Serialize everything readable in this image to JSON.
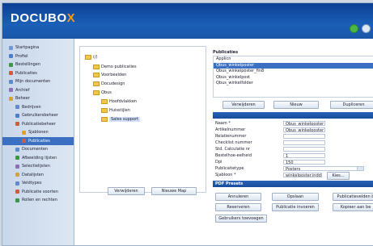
{
  "app": {
    "logo_main": "DOCUBO",
    "logo_accent": "X"
  },
  "colors": {
    "header": "#1b5fb8",
    "accent": "#f59a1b",
    "selection": "#3b6fc2"
  },
  "sidebar": {
    "items": [
      {
        "label": "Startpagina",
        "icon": "home-icon",
        "color": "#6a9ad6"
      },
      {
        "label": "Profiel",
        "icon": "user-icon",
        "color": "#4a7fcf"
      },
      {
        "label": "Bestellingen",
        "icon": "cart-icon",
        "color": "#3a9a44"
      },
      {
        "label": "Publicaties",
        "icon": "book-icon",
        "color": "#d25b3a"
      },
      {
        "label": "Mijn documenten",
        "icon": "document-icon",
        "color": "#5b8bd0"
      },
      {
        "label": "Archief",
        "icon": "archive-icon",
        "color": "#8c6fb8"
      },
      {
        "label": "Beheer",
        "icon": "admin-icon",
        "color": "#d4a33a"
      },
      {
        "label": "Bedrijven",
        "icon": "company-icon",
        "color": "#5b8bd0"
      },
      {
        "label": "Gebruikersbeheer",
        "icon": "users-icon",
        "color": "#4a7fcf"
      },
      {
        "label": "Publicatiebeheer",
        "icon": "publication-icon",
        "color": "#d25b3a"
      },
      {
        "label": "Sjablonen",
        "icon": "template-icon",
        "color": "#e0a21a"
      },
      {
        "label": "Publicaties",
        "icon": "book-icon",
        "color": "#d25b3a",
        "selected": true
      },
      {
        "label": "Documenten",
        "icon": "document-icon",
        "color": "#5b8bd0"
      },
      {
        "label": "Afbeelding lijsten",
        "icon": "image-icon",
        "color": "#3a9a44"
      },
      {
        "label": "Selectielijsten",
        "icon": "list-icon",
        "color": "#8c6fb8"
      },
      {
        "label": "Datalijsten",
        "icon": "data-icon",
        "color": "#d4a33a"
      },
      {
        "label": "Veldtypes",
        "icon": "field-icon",
        "color": "#5b8bd0"
      },
      {
        "label": "Publicatie soorten",
        "icon": "category-icon",
        "color": "#d25b3a"
      },
      {
        "label": "Rollen en rechten",
        "icon": "key-icon",
        "color": "#3a9a44"
      }
    ]
  },
  "tree": {
    "root": "(/)",
    "items": [
      {
        "label": "Demo publicaties",
        "depth": 1
      },
      {
        "label": "Voorbeelden",
        "depth": 1
      },
      {
        "label": "Docudesign",
        "depth": 1
      },
      {
        "label": "Qbus",
        "depth": 1
      },
      {
        "label": "Hoofdvlakken",
        "depth": 2
      },
      {
        "label": "Huisstijlen",
        "depth": 2
      },
      {
        "label": "Sales support",
        "depth": 2,
        "selected": true
      }
    ],
    "buttons": {
      "remove": "Verwijderen",
      "new_folder": "Nieuwe Map"
    }
  },
  "publications": {
    "title": "Publicaties",
    "items": [
      {
        "label": "Applicn"
      },
      {
        "label": "Qbus_winkelposter",
        "selected": true
      },
      {
        "label": "Qbus_winkelposter_fin8"
      },
      {
        "label": "Qbus_winkelpost"
      },
      {
        "label": "Qbus_winkelfolder"
      }
    ],
    "buttons": {
      "remove": "Verwijderen",
      "new": "Nieuw",
      "duplicate": "Dupliceren"
    }
  },
  "form": {
    "fields": [
      {
        "label": "Naam *",
        "value": "Qbus_winkelposter"
      },
      {
        "label": "Artikelnummer",
        "value": "Qbus_winkelposter"
      },
      {
        "label": "Relatienummer",
        "value": ""
      },
      {
        "label": "Checklist nummer",
        "value": ""
      },
      {
        "label": "Std. Calculatie nr",
        "value": ""
      },
      {
        "label": "Bestelhoe-eelheid",
        "value": "1"
      },
      {
        "label": "Dpi",
        "value": "150"
      },
      {
        "label": "Publicatietype",
        "value": "Posters",
        "select": true
      },
      {
        "label": "Sjabloon *",
        "value": "winkelposter.indd"
      }
    ],
    "kies_label": "Kies..."
  },
  "pdf": {
    "title": "PDF Presets"
  },
  "actions": {
    "cancel": "Annuleren",
    "save": "Opslaan",
    "pub_settings": "Publicatievelden b",
    "reserve": "Reserveren",
    "pub_make": "Publicatie invoeren",
    "copy": "Kopieer aan be",
    "user_assign": "Gebruikers toevoegen"
  }
}
